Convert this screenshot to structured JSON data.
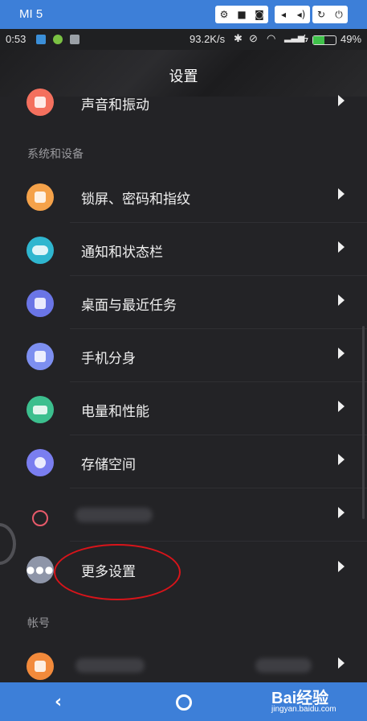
{
  "emulator": {
    "title": "MI 5"
  },
  "status": {
    "time": "0:53",
    "network_speed": "93.2K/s",
    "battery": "49%"
  },
  "header": {
    "title": "设置"
  },
  "sections": {
    "system": "系统和设备",
    "account": "帐号"
  },
  "rows": [
    {
      "label": "声音和振动",
      "color": "#f4705e"
    },
    {
      "label": "锁屏、密码和指纹",
      "color": "#f5a24a"
    },
    {
      "label": "通知和状态栏",
      "color": "#2fb6cf"
    },
    {
      "label": "桌面与最近任务",
      "color": "#6a75e6"
    },
    {
      "label": "手机分身",
      "color": "#7d8ff0"
    },
    {
      "label": "电量和性能",
      "color": "#3cbf8e"
    },
    {
      "label": "存储空间",
      "color": "#7a7ef0"
    },
    {
      "label": "",
      "color": "#e85a6a"
    },
    {
      "label": "更多设置",
      "color": "#8e95a8"
    },
    {
      "label": "",
      "color": "#f28a3b"
    }
  ],
  "navbar": {
    "back_icon": "‹",
    "watermark": "Bai经验",
    "watermark_sub": "jingyan.baidu.com"
  }
}
